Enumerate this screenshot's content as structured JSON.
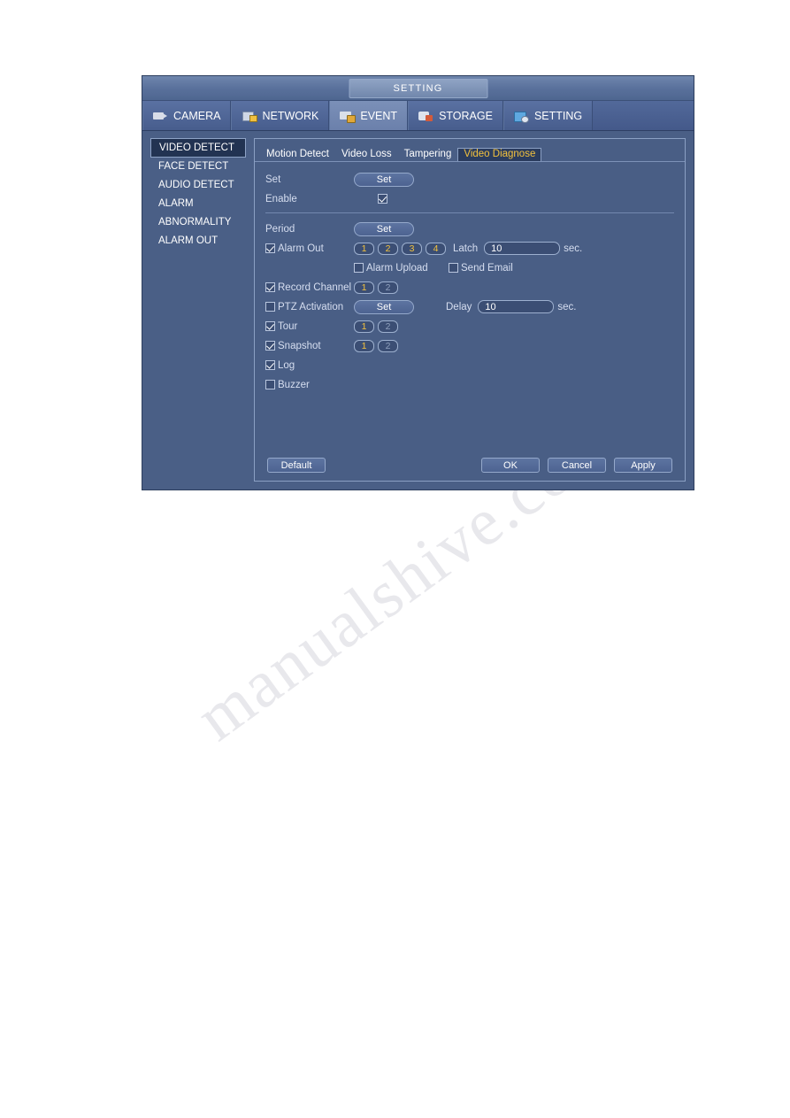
{
  "watermark": "manualshive.com",
  "window": {
    "title": "SETTING",
    "main_tabs": [
      {
        "label": "CAMERA",
        "icon": "camera-icon",
        "active": false
      },
      {
        "label": "NETWORK",
        "icon": "network-icon",
        "active": false
      },
      {
        "label": "EVENT",
        "icon": "event-icon",
        "active": true
      },
      {
        "label": "STORAGE",
        "icon": "storage-icon",
        "active": false
      },
      {
        "label": "SETTING",
        "icon": "setting-icon",
        "active": false
      }
    ],
    "left_menu": [
      {
        "label": "VIDEO DETECT",
        "active": true
      },
      {
        "label": "FACE DETECT",
        "active": false
      },
      {
        "label": "AUDIO DETECT",
        "active": false
      },
      {
        "label": "ALARM",
        "active": false
      },
      {
        "label": "ABNORMALITY",
        "active": false
      },
      {
        "label": "ALARM OUT",
        "active": false
      }
    ],
    "sub_tabs": [
      {
        "label": "Motion Detect",
        "active": false
      },
      {
        "label": "Video Loss",
        "active": false
      },
      {
        "label": "Tampering",
        "active": false
      },
      {
        "label": "Video Diagnose",
        "active": true
      }
    ],
    "form": {
      "set_label": "Set",
      "set_button": "Set",
      "enable_label": "Enable",
      "enable_checked": true,
      "period_label": "Period",
      "period_button": "Set",
      "alarm_out_label": "Alarm Out",
      "alarm_out_checked": true,
      "alarm_out_channels": [
        "1",
        "2",
        "3",
        "4"
      ],
      "latch_label": "Latch",
      "latch_value": "10",
      "latch_unit": "sec.",
      "alarm_upload_label": "Alarm Upload",
      "alarm_upload_checked": false,
      "send_email_label": "Send Email",
      "send_email_checked": false,
      "record_channel_label": "Record Channel",
      "record_channel_checked": true,
      "record_channels": [
        "1",
        "2"
      ],
      "ptz_activation_label": "PTZ Activation",
      "ptz_activation_checked": false,
      "ptz_button": "Set",
      "delay_label": "Delay",
      "delay_value": "10",
      "delay_unit": "sec.",
      "tour_label": "Tour",
      "tour_checked": true,
      "tour_channels": [
        "1",
        "2"
      ],
      "snapshot_label": "Snapshot",
      "snapshot_checked": true,
      "snapshot_channels": [
        "1",
        "2"
      ],
      "log_label": "Log",
      "log_checked": true,
      "buzzer_label": "Buzzer",
      "buzzer_checked": false
    },
    "buttons": {
      "default": "Default",
      "ok": "OK",
      "cancel": "Cancel",
      "apply": "Apply"
    }
  }
}
